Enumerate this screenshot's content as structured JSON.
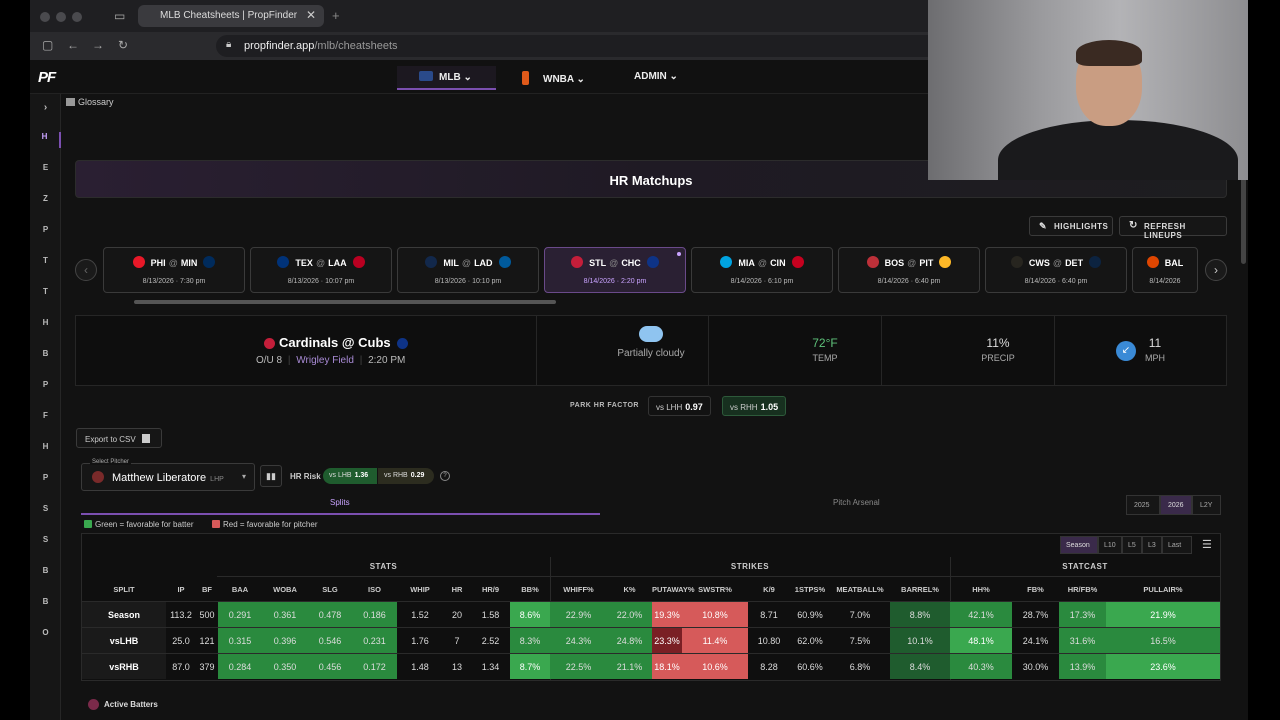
{
  "browser": {
    "tab_title": "MLB Cheatsheets | PropFinder",
    "close_glyph": "✕",
    "new_tab_glyph": "+",
    "url_host": "propfinder.app",
    "url_path": "/mlb/cheatsheets"
  },
  "app": {
    "logo": "PF",
    "nav": [
      {
        "label": "MLB ⌄"
      },
      {
        "label": "WNBA ⌄"
      },
      {
        "label": "ADMIN ⌄"
      }
    ],
    "glossary": "Glossary",
    "rail": [
      "H",
      "E",
      "Z",
      "P",
      "T",
      "T",
      "H",
      "B",
      "P",
      "F",
      "H",
      "P",
      "S",
      "S",
      "B",
      "B",
      "O"
    ]
  },
  "page": {
    "title": "HR Matchups",
    "highlights": "HIGHLIGHTS",
    "refresh": "REFRESH LINEUPS",
    "prev": "‹",
    "next": "›"
  },
  "games": [
    {
      "away": "PHI",
      "home": "MIN",
      "at": "@",
      "date": "8/13/2026 · 7:30 pm",
      "c1": "#e81828",
      "c2": "#002b5c"
    },
    {
      "away": "TEX",
      "home": "LAA",
      "at": "@",
      "date": "8/13/2026 · 10:07 pm",
      "c1": "#003278",
      "c2": "#ba0021"
    },
    {
      "away": "MIL",
      "home": "LAD",
      "at": "@",
      "date": "8/13/2026 · 10:10 pm",
      "c1": "#12284b",
      "c2": "#005a9c"
    },
    {
      "away": "STL",
      "home": "CHC",
      "at": "@",
      "date": "8/14/2026 · 2:20 pm",
      "c1": "#c41e3a",
      "c2": "#0e3386"
    },
    {
      "away": "MIA",
      "home": "CIN",
      "at": "@",
      "date": "8/14/2026 · 6:10 pm",
      "c1": "#00a3e0",
      "c2": "#c6011f"
    },
    {
      "away": "BOS",
      "home": "PIT",
      "at": "@",
      "date": "8/14/2026 · 6:40 pm",
      "c1": "#bd3039",
      "c2": "#fdb827"
    },
    {
      "away": "CWS",
      "home": "DET",
      "at": "@",
      "date": "8/14/2026 · 6:40 pm",
      "c1": "#27251f",
      "c2": "#0c2340"
    },
    {
      "away": "BAL",
      "home": "",
      "at": "",
      "date": "8/14/2026",
      "c1": "#df4601",
      "c2": "#df4601"
    }
  ],
  "matchup": {
    "title": "Cardinals @ Cubs",
    "ou": "O/U 8",
    "venue": "Wrigley Field",
    "time": "2:20 PM",
    "weather": "Partially cloudy",
    "temp": "72°F",
    "temp_label": "TEMP",
    "precip": "11%",
    "precip_label": "PRECIP",
    "wind": "11",
    "wind_label": "MPH"
  },
  "park": {
    "label": "PARK HR FACTOR",
    "lhh_label": "vs LHH",
    "lhh": "0.97",
    "rhh_label": "vs RHH",
    "rhh": "1.05"
  },
  "pitcher": {
    "export": "Export to CSV",
    "select_label": "Select Pitcher",
    "name": "Matthew Liberatore",
    "hand": "LHP",
    "hr_risk_label": "HR Risk",
    "lhb_label": "vs LHB",
    "lhb": "1.36",
    "rhb_label": "vs RHB",
    "rhb": "0.29"
  },
  "tabs": {
    "splits": "Splits",
    "arsenal": "Pitch Arsenal",
    "years": [
      "2025",
      "2026",
      "L2Y"
    ],
    "legend_green": "Green = favorable for batter",
    "legend_red": "Red = favorable for pitcher",
    "ranges": [
      "Season",
      "L10",
      "L5",
      "L3",
      "Last"
    ]
  },
  "table": {
    "groups": [
      "STATS",
      "STRIKES",
      "STATCAST"
    ],
    "headers": [
      "SPLIT",
      "IP",
      "BF",
      "BAA",
      "WOBA",
      "SLG",
      "ISO",
      "WHIP",
      "HR",
      "HR/9",
      "BB%",
      "WHIFF%",
      "K%",
      "PUTAWAY%",
      "SWSTR%",
      "K/9",
      "1STPS%",
      "MEATBALL%",
      "BARREL%",
      "HH%",
      "FB%",
      "HR/FB%",
      "PULLAIR%"
    ],
    "rows": [
      [
        "Season",
        "113.2",
        "500",
        "0.291",
        "0.361",
        "0.478",
        "0.186",
        "1.52",
        "20",
        "1.58",
        "8.6%",
        "22.9%",
        "22.0%",
        "19.3%",
        "10.8%",
        "8.71",
        "60.9%",
        "7.0%",
        "8.8%",
        "42.1%",
        "28.7%",
        "17.3%",
        "21.9%"
      ],
      [
        "vsLHB",
        "25.0",
        "121",
        "0.315",
        "0.396",
        "0.546",
        "0.231",
        "1.76",
        "7",
        "2.52",
        "8.3%",
        "24.3%",
        "24.8%",
        "23.3%",
        "11.4%",
        "10.80",
        "62.0%",
        "7.5%",
        "10.1%",
        "48.1%",
        "24.1%",
        "31.6%",
        "16.5%"
      ],
      [
        "vsRHB",
        "87.0",
        "379",
        "0.284",
        "0.350",
        "0.456",
        "0.172",
        "1.48",
        "13",
        "1.34",
        "8.7%",
        "22.5%",
        "21.1%",
        "18.1%",
        "10.6%",
        "8.28",
        "60.6%",
        "6.8%",
        "8.4%",
        "40.3%",
        "30.0%",
        "13.9%",
        "23.6%"
      ]
    ],
    "shades": [
      [
        "split",
        "",
        "",
        "g2",
        "g2",
        "g2",
        "g2",
        "",
        "",
        "",
        "g3",
        "g2",
        "g2",
        "r1",
        "r1",
        "",
        "",
        "",
        "g1",
        "g2",
        "",
        "g2",
        "g3"
      ],
      [
        "split",
        "",
        "",
        "g2",
        "g2",
        "g2",
        "g2",
        "",
        "",
        "",
        "g2",
        "g2",
        "g2",
        "r2",
        "r1",
        "",
        "",
        "",
        "g1",
        "g3",
        "",
        "g2",
        "g2"
      ],
      [
        "split",
        "",
        "",
        "g2",
        "g2",
        "g2",
        "g2",
        "",
        "",
        "",
        "g3",
        "g2",
        "g2",
        "r1",
        "r1",
        "",
        "",
        "",
        "g1",
        "g2",
        "",
        "g2",
        "g3"
      ]
    ]
  },
  "footer": {
    "active_batters": "Active Batters"
  }
}
